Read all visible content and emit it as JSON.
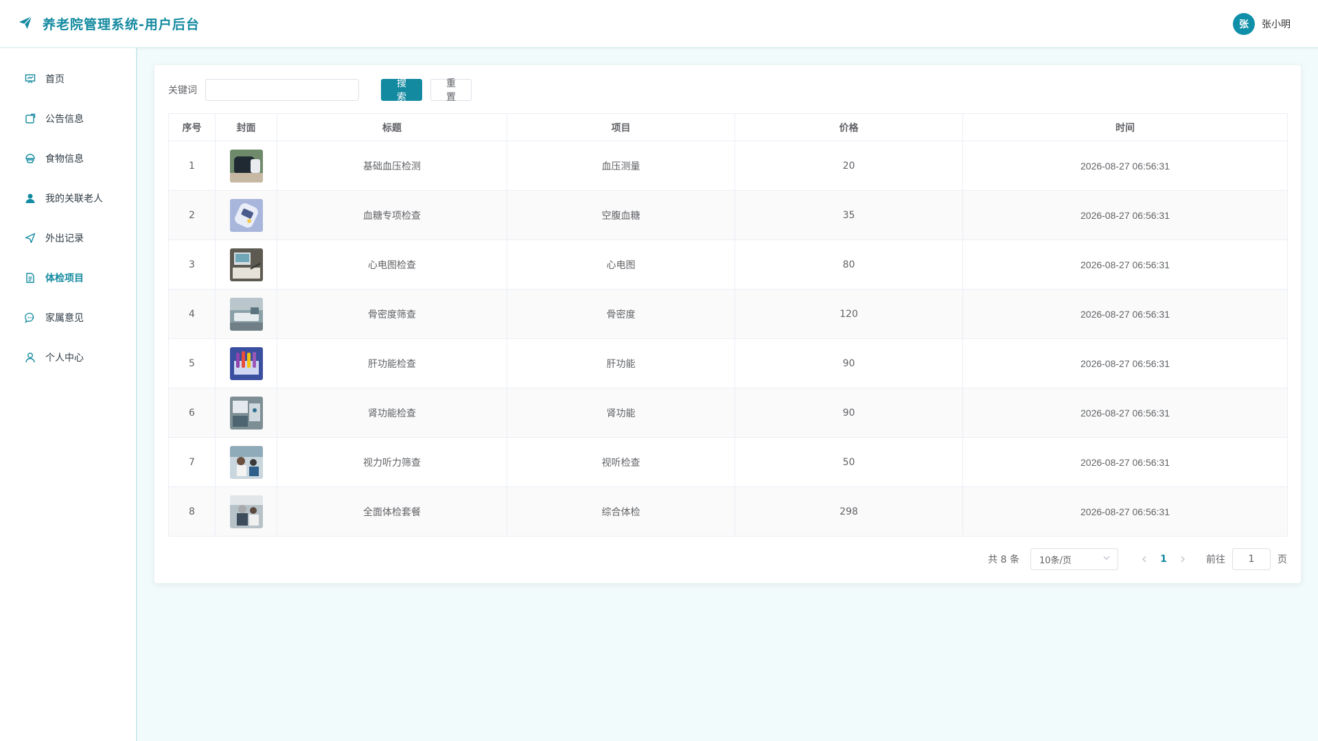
{
  "app": {
    "title": "养老院管理系统-用户后台",
    "accent": "#138aa0"
  },
  "user": {
    "avatar_letter": "张",
    "name": "张小明"
  },
  "sidebar": {
    "items": [
      {
        "label": "首页",
        "icon": "presentation-icon",
        "active": false
      },
      {
        "label": "公告信息",
        "icon": "notice-icon",
        "active": false
      },
      {
        "label": "食物信息",
        "icon": "food-icon",
        "active": false
      },
      {
        "label": "我的关联老人",
        "icon": "user-filled-icon",
        "active": false
      },
      {
        "label": "外出记录",
        "icon": "send-icon",
        "active": false
      },
      {
        "label": "体检项目",
        "icon": "document-icon",
        "active": true
      },
      {
        "label": "家属意见",
        "icon": "chat-icon",
        "active": false
      },
      {
        "label": "个人中心",
        "icon": "user-outline-icon",
        "active": false
      }
    ]
  },
  "search": {
    "label": "关键词",
    "value": "",
    "placeholder": "",
    "search_button": "搜索",
    "reset_button": "重置"
  },
  "table": {
    "headers": [
      "序号",
      "封面",
      "标题",
      "项目",
      "价格",
      "时间"
    ],
    "rows": [
      {
        "index": "1",
        "cover": "blood-pressure-photo",
        "title": "基础血压检测",
        "item": "血压测量",
        "price": "20",
        "time": "2026-08-27 06:56:31"
      },
      {
        "index": "2",
        "cover": "glucose-meter-photo",
        "title": "血糖专项检查",
        "item": "空腹血糖",
        "price": "35",
        "time": "2026-08-27 06:56:31"
      },
      {
        "index": "3",
        "cover": "ecg-photo",
        "title": "心电图检查",
        "item": "心电图",
        "price": "80",
        "time": "2026-08-27 06:56:31"
      },
      {
        "index": "4",
        "cover": "bone-density-photo",
        "title": "骨密度筛查",
        "item": "骨密度",
        "price": "120",
        "time": "2026-08-27 06:56:31"
      },
      {
        "index": "5",
        "cover": "liver-test-photo",
        "title": "肝功能检查",
        "item": "肝功能",
        "price": "90",
        "time": "2026-08-27 06:56:31"
      },
      {
        "index": "6",
        "cover": "kidney-test-photo",
        "title": "肾功能检查",
        "item": "肾功能",
        "price": "90",
        "time": "2026-08-27 06:56:31"
      },
      {
        "index": "7",
        "cover": "vision-hearing-photo",
        "title": "视力听力筛查",
        "item": "视听检查",
        "price": "50",
        "time": "2026-08-27 06:56:31"
      },
      {
        "index": "8",
        "cover": "full-checkup-photo",
        "title": "全面体检套餐",
        "item": "综合体检",
        "price": "298",
        "time": "2026-08-27 06:56:31"
      }
    ]
  },
  "pagination": {
    "total_text": "共 8 条",
    "page_size": "10条/页",
    "current_page": "1",
    "goto_label": "前往",
    "goto_value": "1",
    "unit_label": "页"
  }
}
